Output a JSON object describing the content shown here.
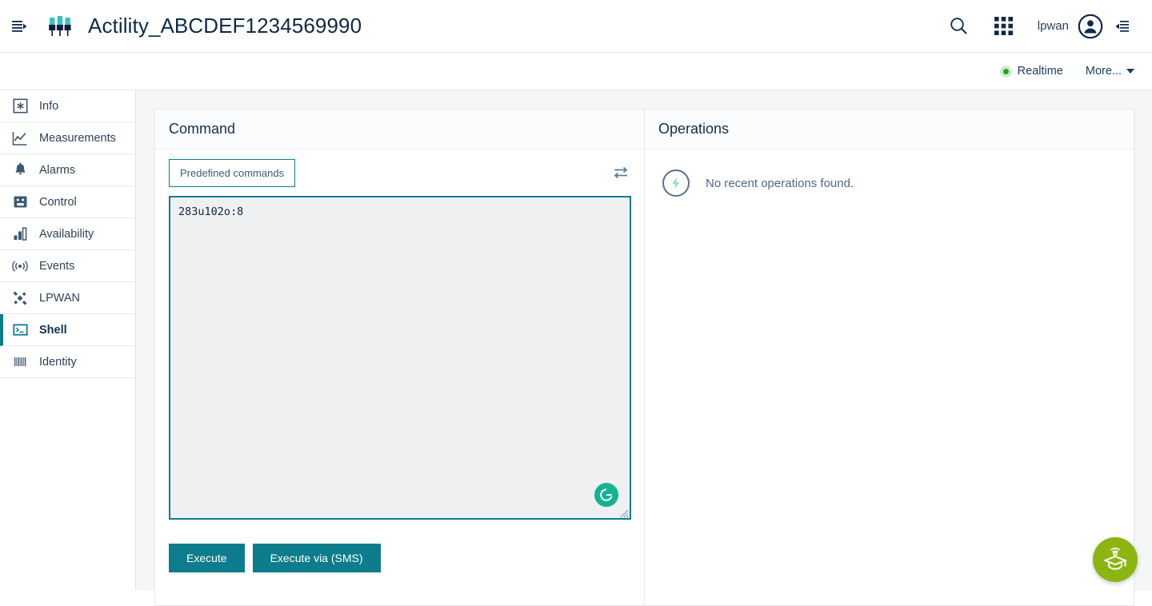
{
  "header": {
    "menu_icon": "expand-panel-icon",
    "device_icon": "lpwan-device-icon",
    "title": "Actility_ABCDEF1234569990",
    "search_icon": "search-icon",
    "apps_icon": "app-grid-icon",
    "username": "lpwan",
    "avatar_icon": "user-avatar-icon",
    "collapse_icon": "collapse-right-panel-icon"
  },
  "subbar": {
    "realtime_label": "Realtime",
    "realtime_status_color": "#22a522",
    "more_label": "More...",
    "caret_icon": "chevron-down-icon"
  },
  "sidebar": {
    "items": [
      {
        "label": "Info",
        "icon": "info-asterisk-icon",
        "active": false
      },
      {
        "label": "Measurements",
        "icon": "line-chart-icon",
        "active": false
      },
      {
        "label": "Alarms",
        "icon": "bell-icon",
        "active": false
      },
      {
        "label": "Control",
        "icon": "control-panel-icon",
        "active": false
      },
      {
        "label": "Availability",
        "icon": "bar-chart-icon",
        "active": false
      },
      {
        "label": "Events",
        "icon": "broadcast-icon",
        "active": false
      },
      {
        "label": "LPWAN",
        "icon": "satellite-icon",
        "active": false
      },
      {
        "label": "Shell",
        "icon": "terminal-icon",
        "active": true
      },
      {
        "label": "Identity",
        "icon": "barcode-icon",
        "active": false
      }
    ]
  },
  "command_panel": {
    "title": "Command",
    "predefined_commands_label": "Predefined commands",
    "swap_icon": "transfer-arrows-icon",
    "textarea_value": "283u102o:8",
    "textarea_placeholder": "",
    "grammarly_badge": "G",
    "resize_handle_icon": "resize-grip-icon",
    "execute_label": "Execute",
    "execute_sms_label": "Execute via (SMS)"
  },
  "operations_panel": {
    "title": "Operations",
    "empty_icon": "lightning-bolt-icon",
    "empty_text": "No recent operations found."
  },
  "fab": {
    "icon": "graduation-cap-icon",
    "color": "#8cb512"
  },
  "colors": {
    "accent_teal": "#0d7c8c",
    "title_navy": "#0e2a47",
    "textarea_bg": "#eff0f2",
    "content_bg": "#f5f6f7"
  }
}
